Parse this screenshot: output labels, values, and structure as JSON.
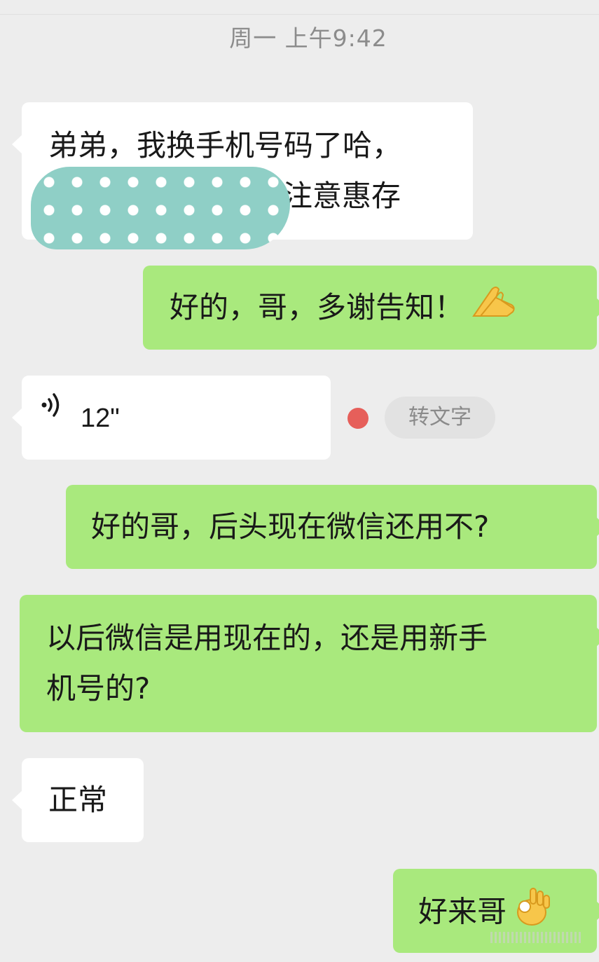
{
  "chat": {
    "timestamp": "周一 上午9:42",
    "messages": [
      {
        "sender": "contact",
        "type": "text",
        "lines": [
          "弟弟，我换手机号码了哈，",
          "注意惠存"
        ],
        "redacted": true
      },
      {
        "sender": "me",
        "type": "text",
        "text": "好的，哥，多谢告知！",
        "emoji": "folded-hands-emoji"
      },
      {
        "sender": "contact",
        "type": "voice",
        "duration": "12\"",
        "unread": true,
        "transcribe_label": "转文字"
      },
      {
        "sender": "me",
        "type": "text",
        "text": "好的哥，后头现在微信还用不?"
      },
      {
        "sender": "me",
        "type": "text",
        "lines": [
          "以后微信是用现在的，还是用新手",
          "机号的?"
        ]
      },
      {
        "sender": "contact",
        "type": "text",
        "text": "正常"
      },
      {
        "sender": "me",
        "type": "text",
        "text": "好来哥",
        "emoji": "ok-hand-emoji"
      }
    ]
  },
  "colors": {
    "background": "#ededed",
    "incoming_bubble": "#ffffff",
    "outgoing_bubble": "#a9e97d",
    "unread_dot": "#e65f5a",
    "redaction": "#8fcfc6"
  }
}
